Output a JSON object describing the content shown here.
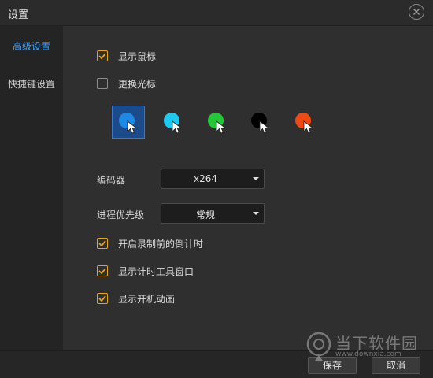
{
  "window": {
    "title": "设置"
  },
  "sidebar": {
    "items": [
      {
        "label": "高级设置",
        "active": true
      },
      {
        "label": "快捷键设置",
        "active": false
      }
    ]
  },
  "options": {
    "show_mouse": {
      "label": "显示鼠标",
      "checked": true
    },
    "change_cursor": {
      "label": "更换光标",
      "checked": false
    },
    "countdown": {
      "label": "开启录制前的倒计时",
      "checked": true
    },
    "toolbar_window": {
      "label": "显示计时工具窗口",
      "checked": true
    },
    "boot_animation": {
      "label": "显示开机动画",
      "checked": true
    }
  },
  "cursors": [
    {
      "name": "blue",
      "color": "#1e88e5",
      "selected": true
    },
    {
      "name": "cyan",
      "color": "#1ecbf0",
      "selected": false
    },
    {
      "name": "green",
      "color": "#22c83a",
      "selected": false
    },
    {
      "name": "black",
      "color": "#000000",
      "selected": false
    },
    {
      "name": "orange",
      "color": "#ee4a12",
      "selected": false
    }
  ],
  "encoder": {
    "label": "编码器",
    "value": "x264"
  },
  "priority": {
    "label": "进程优先级",
    "value": "常规"
  },
  "footer": {
    "save_label": "保存",
    "cancel_label": "取消"
  },
  "watermark": {
    "name": "当下软件园",
    "url": "www.downxia.com"
  },
  "colors": {
    "accent": "#3d9bf3",
    "checkbox": "#e6a614"
  }
}
